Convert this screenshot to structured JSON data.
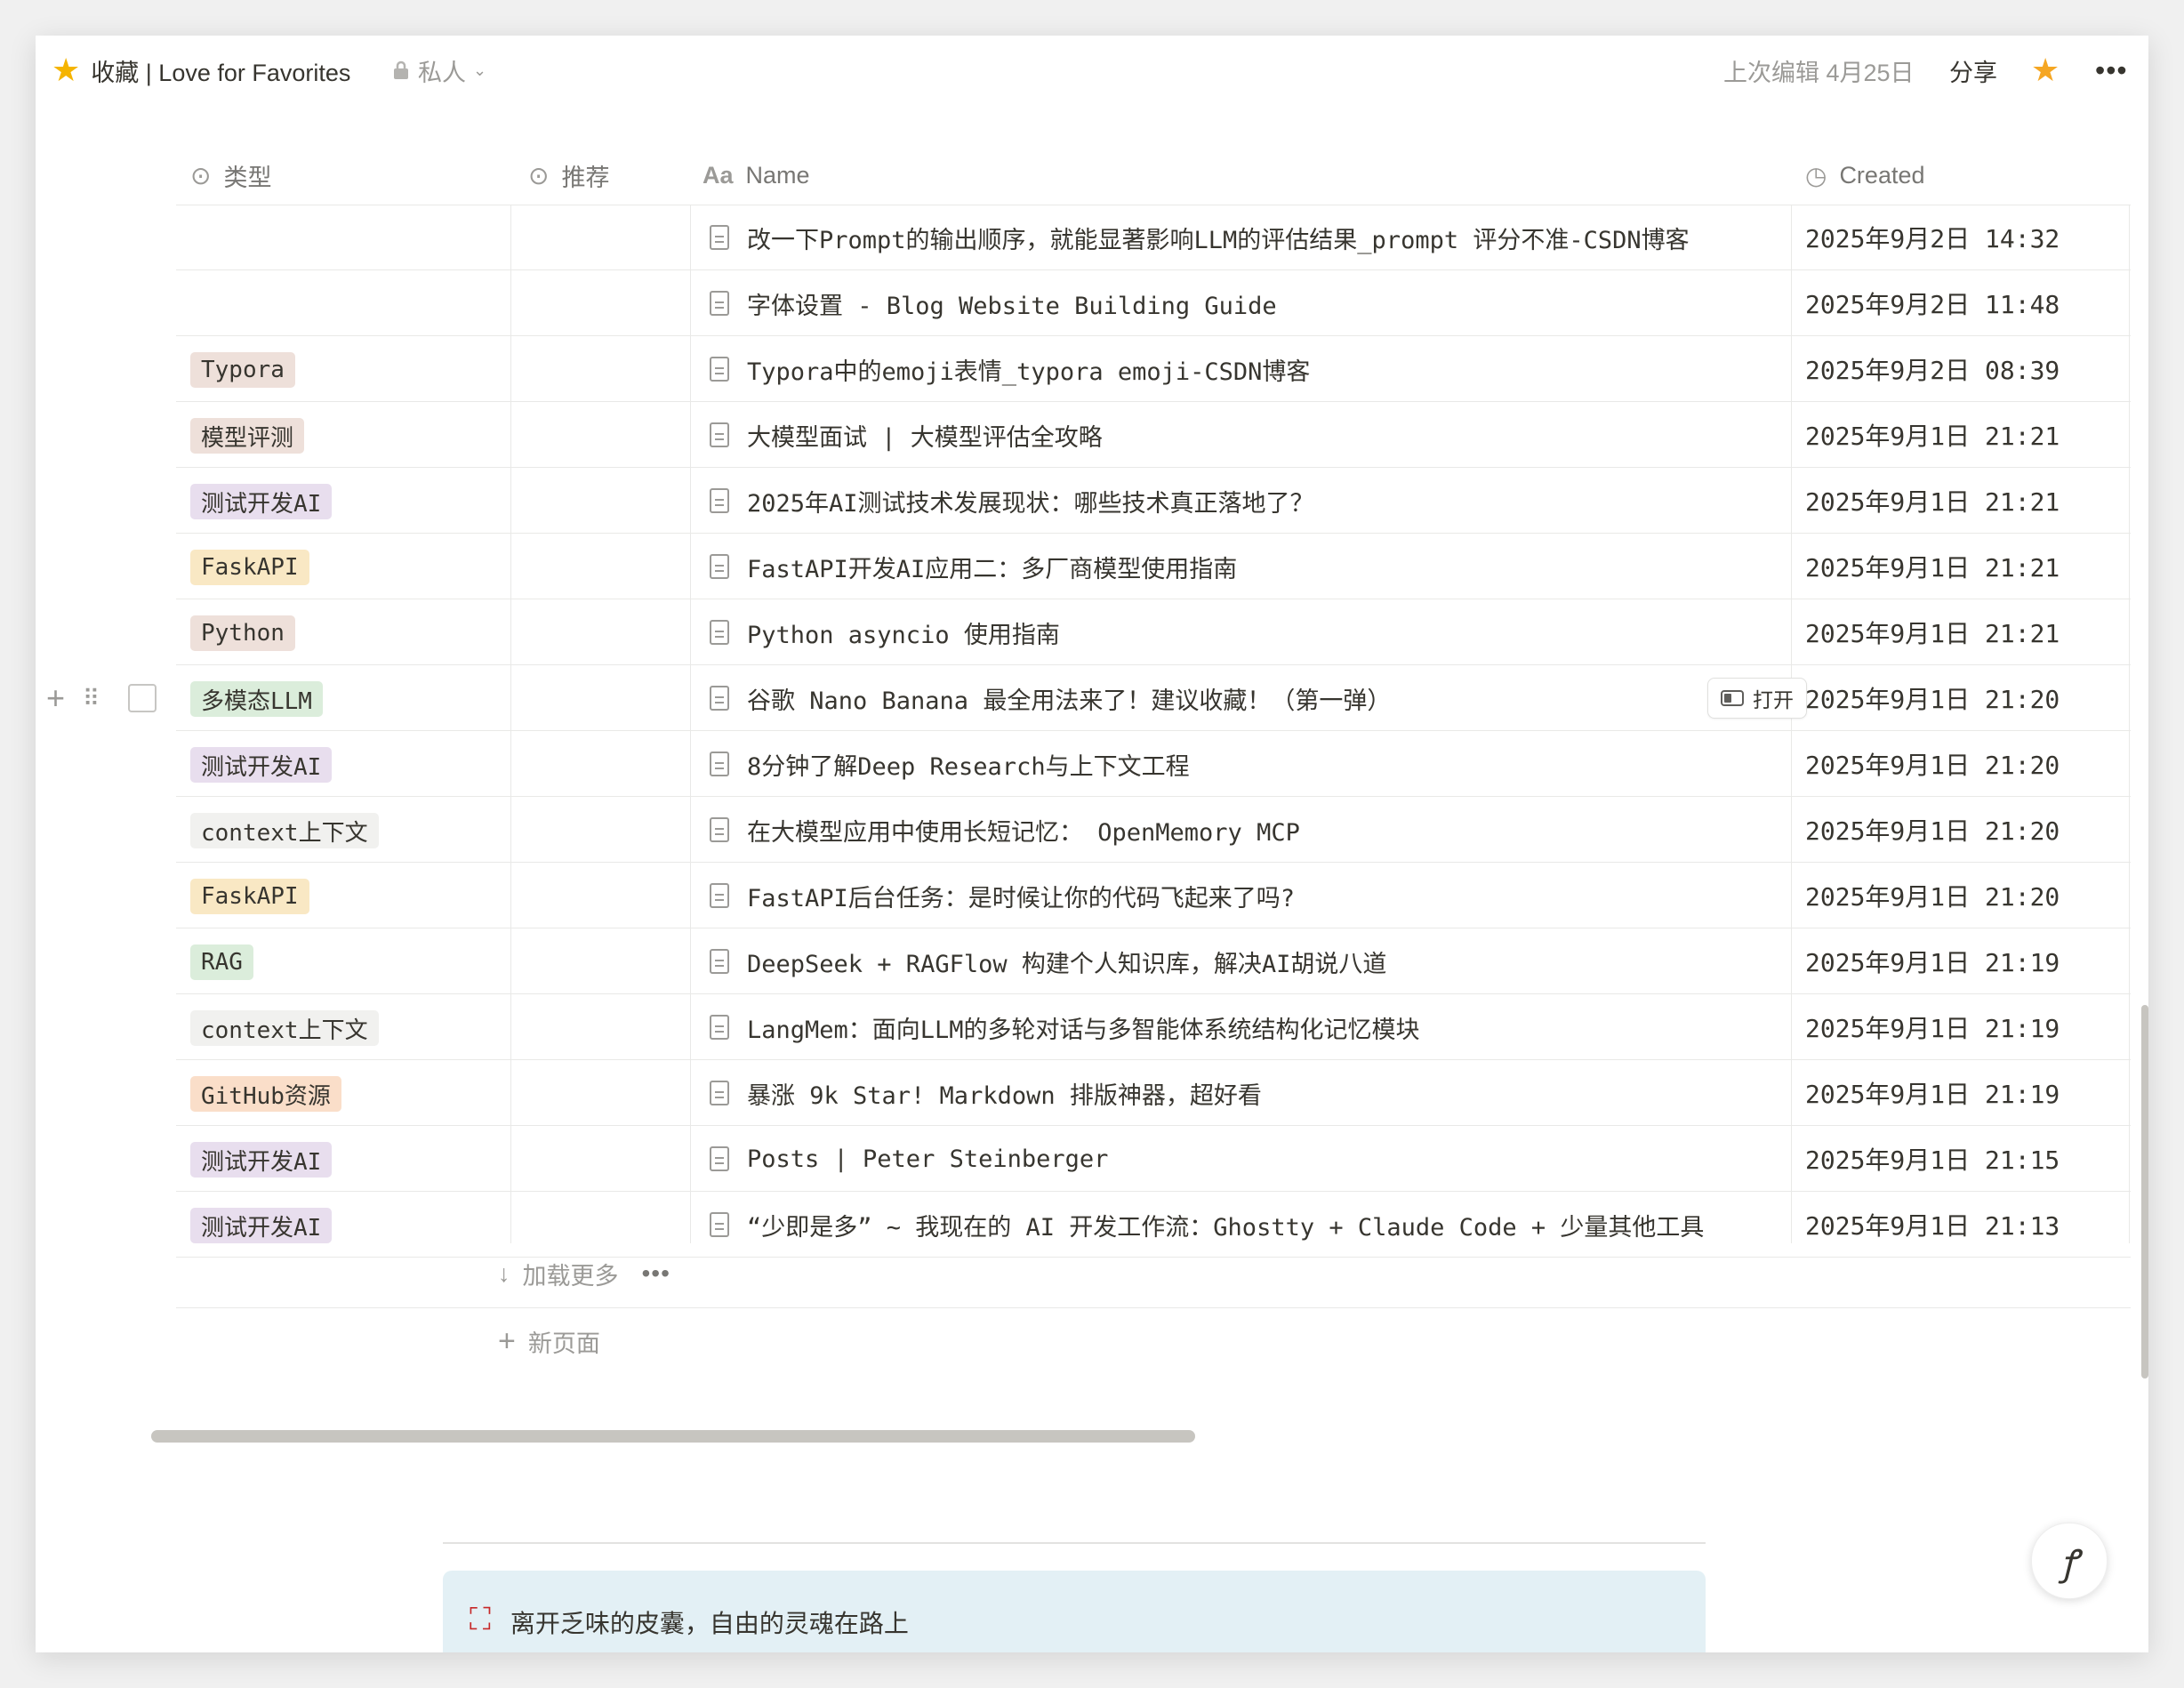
{
  "topbar": {
    "title": "收藏 | Love for Favorites",
    "privacy": "私人",
    "last_edited": "上次编辑 4月25日",
    "share": "分享"
  },
  "columns": {
    "type": "类型",
    "recommend": "推荐",
    "name": "Name",
    "created": "Created"
  },
  "rows": [
    {
      "tag": "",
      "tag_color": "",
      "name": "改一下Prompt的输出顺序，就能显著影响LLM的评估结果_prompt 评分不准-CSDN博客",
      "created": "2025年9月2日 14:32"
    },
    {
      "tag": "",
      "tag_color": "",
      "name": "字体设置 - Blog Website Building Guide",
      "created": "2025年9月2日 11:48"
    },
    {
      "tag": "Typora",
      "tag_color": "#eee0da",
      "name": "Typora中的emoji表情_typora emoji-CSDN博客",
      "created": "2025年9月2日 08:39"
    },
    {
      "tag": "模型评测",
      "tag_color": "#eee0da",
      "name": "大模型面试 | 大模型评估全攻略",
      "created": "2025年9月1日 21:21"
    },
    {
      "tag": "测试开发AI",
      "tag_color": "#e8deee",
      "name": "2025年AI测试技术发展现状：哪些技术真正落地了？",
      "created": "2025年9月1日 21:21"
    },
    {
      "tag": "FaskAPI",
      "tag_color": "#f9e8c4",
      "name": "FastAPI开发AI应用二：多厂商模型使用指南",
      "created": "2025年9月1日 21:21"
    },
    {
      "tag": "Python",
      "tag_color": "#eee0da",
      "name": "Python asyncio 使用指南",
      "created": "2025年9月1日 21:21"
    },
    {
      "tag": "多模态LLM",
      "tag_color": "#dbeddb",
      "name": "谷歌 Nano Banana 最全用法来了！建议收藏！（第一弹）",
      "created": "2025年9月1日 21:20",
      "hover": true
    },
    {
      "tag": "测试开发AI",
      "tag_color": "#e8deee",
      "name": "8分钟了解Deep Research与上下文工程",
      "created": "2025年9月1日 21:20"
    },
    {
      "tag": "context上下文",
      "tag_color": "#f1f1ef",
      "name": "在大模型应用中使用长短记忆： OpenMemory MCP",
      "created": "2025年9月1日 21:20"
    },
    {
      "tag": "FaskAPI",
      "tag_color": "#f9e8c4",
      "name": "FastAPI后台任务：是时候让你的代码飞起来了吗?",
      "created": "2025年9月1日 21:20"
    },
    {
      "tag": "RAG",
      "tag_color": "#dbeddb",
      "name": "DeepSeek + RAGFlow 构建个人知识库，解决AI胡说八道",
      "created": "2025年9月1日 21:19"
    },
    {
      "tag": "context上下文",
      "tag_color": "#f1f1ef",
      "name": "LangMem：面向LLM的多轮对话与多智能体系统结构化记忆模块",
      "created": "2025年9月1日 21:19"
    },
    {
      "tag": "GitHub资源",
      "tag_color": "#fadec9",
      "name": "暴涨 9k Star! Markdown 排版神器，超好看",
      "created": "2025年9月1日 21:19"
    },
    {
      "tag": "测试开发AI",
      "tag_color": "#e8deee",
      "name": "Posts | Peter Steinberger",
      "created": "2025年9月1日 21:15"
    },
    {
      "tag": "测试开发AI",
      "tag_color": "#e8deee",
      "name": "“少即是多” ~ 我现在的 AI 开发工作流：Ghostty + Claude Code + 少量其他工具",
      "created": "2025年9月1日 21:13"
    }
  ],
  "open_button": "打开",
  "load_more": "加载更多",
  "new_page": "新页面",
  "callout": {
    "text": "离开乏味的皮囊，自由的灵魂在路上"
  },
  "colors": {
    "accent_star": "#f5a623",
    "border": "#e9e9e7",
    "muted_text": "#9b9a97"
  }
}
